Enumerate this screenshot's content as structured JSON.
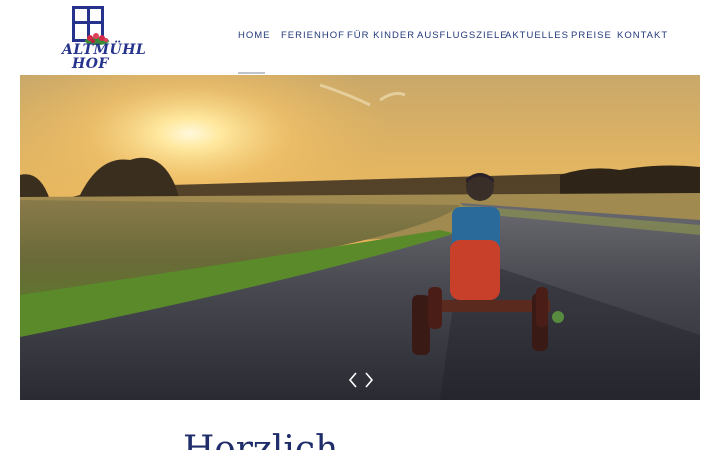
{
  "logo": {
    "line1": "ALTMÜHL",
    "line2": "HOF"
  },
  "nav": {
    "home": "HOME",
    "ferienhof": "FERIENHOF",
    "fuer_kinder": "FÜR KINDER",
    "ausflugsziele": "AUSFLUGSZIELE",
    "aktuelles": "AKTUELLES",
    "preise": "PREISE",
    "kontakt": "KONTAKT"
  },
  "slider": {
    "prev_symbol": "‹",
    "next_symbol": "›"
  },
  "main": {
    "heading": "Herzlich"
  },
  "colors": {
    "brand": "#25338c",
    "nav_text": "#253a7a",
    "heading": "#1f2e6b"
  }
}
